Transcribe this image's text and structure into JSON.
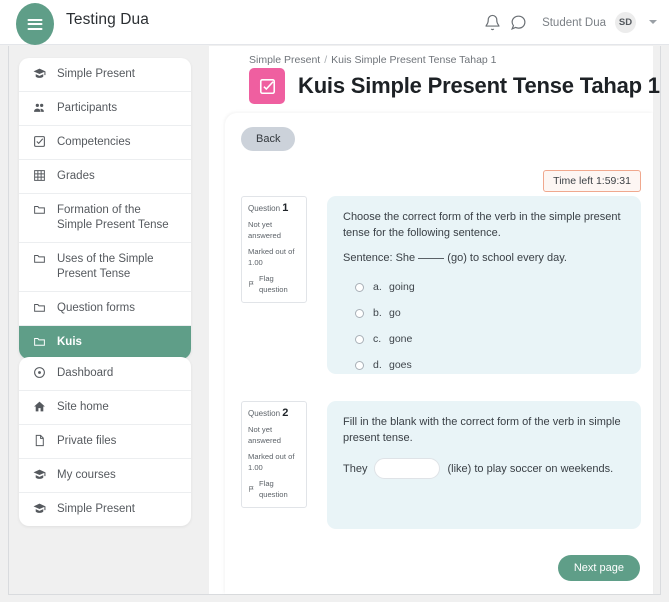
{
  "topbar": {
    "menu_icon": "hamburger-icon",
    "site_title": "Testing Dua",
    "notifications_icon": "bell-icon",
    "messages_icon": "chat-bubble-icon",
    "user_name": "Student Dua",
    "user_initials": "SD",
    "caret_icon": "chevron-down-icon"
  },
  "sidebar": {
    "groups": [
      {
        "items": [
          {
            "label": "Simple Present",
            "icon": "graduation-cap-icon",
            "active": false
          },
          {
            "label": "Participants",
            "icon": "users-icon",
            "active": false
          },
          {
            "label": "Competencies",
            "icon": "check-square-icon",
            "active": false
          },
          {
            "label": "Grades",
            "icon": "table-grid-icon",
            "active": false
          },
          {
            "label": "Formation of the Simple Present Tense",
            "icon": "folder-icon",
            "active": false
          },
          {
            "label": "Uses of the Simple Present Tense",
            "icon": "folder-icon",
            "active": false
          },
          {
            "label": "Question forms",
            "icon": "folder-icon",
            "active": false
          },
          {
            "label": "Kuis",
            "icon": "folder-icon",
            "active": true
          }
        ]
      },
      {
        "items": [
          {
            "label": "Dashboard",
            "icon": "dashboard-icon",
            "active": false
          },
          {
            "label": "Site home",
            "icon": "home-icon",
            "active": false
          },
          {
            "label": "Private files",
            "icon": "file-icon",
            "active": false
          },
          {
            "label": "My courses",
            "icon": "graduation-cap-icon",
            "active": false
          },
          {
            "label": "Simple Present",
            "icon": "graduation-cap-icon",
            "active": false
          }
        ]
      }
    ]
  },
  "main": {
    "breadcrumb": {
      "parent": "Simple Present",
      "separator": "/",
      "current": "Kuis Simple Present Tense Tahap 1"
    },
    "page_title": "Kuis Simple Present Tense Tahap 1",
    "title_icon": "quiz-check-square-icon",
    "back_label": "Back",
    "timer_label": "Time left 1:59:31",
    "next_page_label": "Next page"
  },
  "questions": [
    {
      "number_label": "Question",
      "number": "1",
      "state": "Not yet answered",
      "marked_out_of": "Marked out of 1.00",
      "flag_label": "Flag question",
      "flag_icon": "flag-icon",
      "prompt_line1": "Choose the correct form of the verb in the simple present tense for the following sentence.",
      "prompt_line2_pre": "Sentence: She",
      "prompt_line2_post": "(go) to school every day.",
      "options": [
        {
          "letter": "a.",
          "text": "going",
          "selected": false
        },
        {
          "letter": "b.",
          "text": "go",
          "selected": false
        },
        {
          "letter": "c.",
          "text": "gone",
          "selected": false
        },
        {
          "letter": "d.",
          "text": "goes",
          "selected": false
        }
      ]
    },
    {
      "number_label": "Question",
      "number": "2",
      "state": "Not yet answered",
      "marked_out_of": "Marked out of 1.00",
      "flag_label": "Flag question",
      "flag_icon": "flag-icon",
      "prompt_line1": "Fill in the blank with the correct form of the verb in simple present tense.",
      "fill_pre": "They",
      "fill_value": "",
      "fill_post": "(like) to play soccer on weekends."
    }
  ],
  "colors": {
    "brand_green": "#5f9e88",
    "accent_pink": "#ef5fa0",
    "question_bg": "#e9f4f7",
    "timer_border": "#f0a88e",
    "page_bg": "#f0f0f0"
  }
}
